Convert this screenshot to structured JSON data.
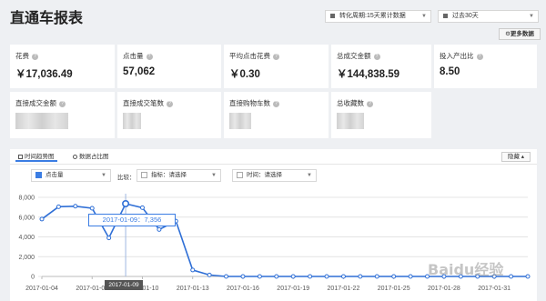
{
  "page": {
    "title": "直通车报表"
  },
  "header": {
    "period_select": "转化周期:15天累计数据",
    "range_select": "过去30天",
    "more_button": "更多数据"
  },
  "metrics": [
    {
      "label": "花费",
      "value": "￥17,036.49"
    },
    {
      "label": "点击量",
      "value": "57,062"
    },
    {
      "label": "平均点击花费",
      "value": "￥0.30"
    },
    {
      "label": "总成交金额",
      "value": "￥144,838.59"
    },
    {
      "label": "投入产出比",
      "value": "8.50"
    },
    {
      "label": "直接成交金额",
      "value": ""
    },
    {
      "label": "直接成交笔数",
      "value": ""
    },
    {
      "label": "直接购物车数",
      "value": ""
    },
    {
      "label": "总收藏数",
      "value": ""
    }
  ],
  "chart_panel": {
    "tab_trend": "时间趋势图",
    "tab_ratio": "数据占比图",
    "hide_button": "隐藏",
    "metric_select": "点击量",
    "compare_label": "比较：",
    "indicator_select": "指标：请选择",
    "time_select": "时间：请选择",
    "tooltip": "2017-01-09：7,356",
    "hover_badge": "2017-01-09",
    "watermark": "Baidu经验"
  },
  "colors": {
    "accent": "#3b7de3",
    "line": "#2f6fd6"
  },
  "chart_data": {
    "type": "line",
    "x": [
      "2017-01-04",
      "2017-01-05",
      "2017-01-06",
      "2017-01-07",
      "2017-01-08",
      "2017-01-09",
      "2017-01-10",
      "2017-01-11",
      "2017-01-12",
      "2017-01-13",
      "2017-01-14",
      "2017-01-15",
      "2017-01-16",
      "2017-01-17",
      "2017-01-18",
      "2017-01-19",
      "2017-01-20",
      "2017-01-21",
      "2017-01-22",
      "2017-01-23",
      "2017-01-24",
      "2017-01-25",
      "2017-01-26",
      "2017-01-27",
      "2017-01-28",
      "2017-01-29",
      "2017-01-30",
      "2017-01-31",
      "2017-02-01",
      "2017-02-02"
    ],
    "xticks": [
      "2017-01-04",
      "2017-01-07",
      "2017-01-10",
      "2017-01-13",
      "2017-01-16",
      "2017-01-19",
      "2017-01-22",
      "2017-01-25",
      "2017-01-28",
      "2017-01-31"
    ],
    "series": [
      {
        "name": "点击量",
        "values": [
          5800,
          7050,
          7100,
          6900,
          3900,
          7356,
          6950,
          4750,
          5600,
          650,
          150,
          0,
          0,
          0,
          0,
          0,
          0,
          0,
          0,
          0,
          0,
          0,
          0,
          0,
          0,
          0,
          0,
          0,
          0,
          0
        ]
      }
    ],
    "yticks": [
      "0",
      "2,000",
      "4,000",
      "6,000",
      "8,000"
    ],
    "ylim": [
      0,
      8000
    ],
    "highlight_index": 5,
    "grid": true
  }
}
